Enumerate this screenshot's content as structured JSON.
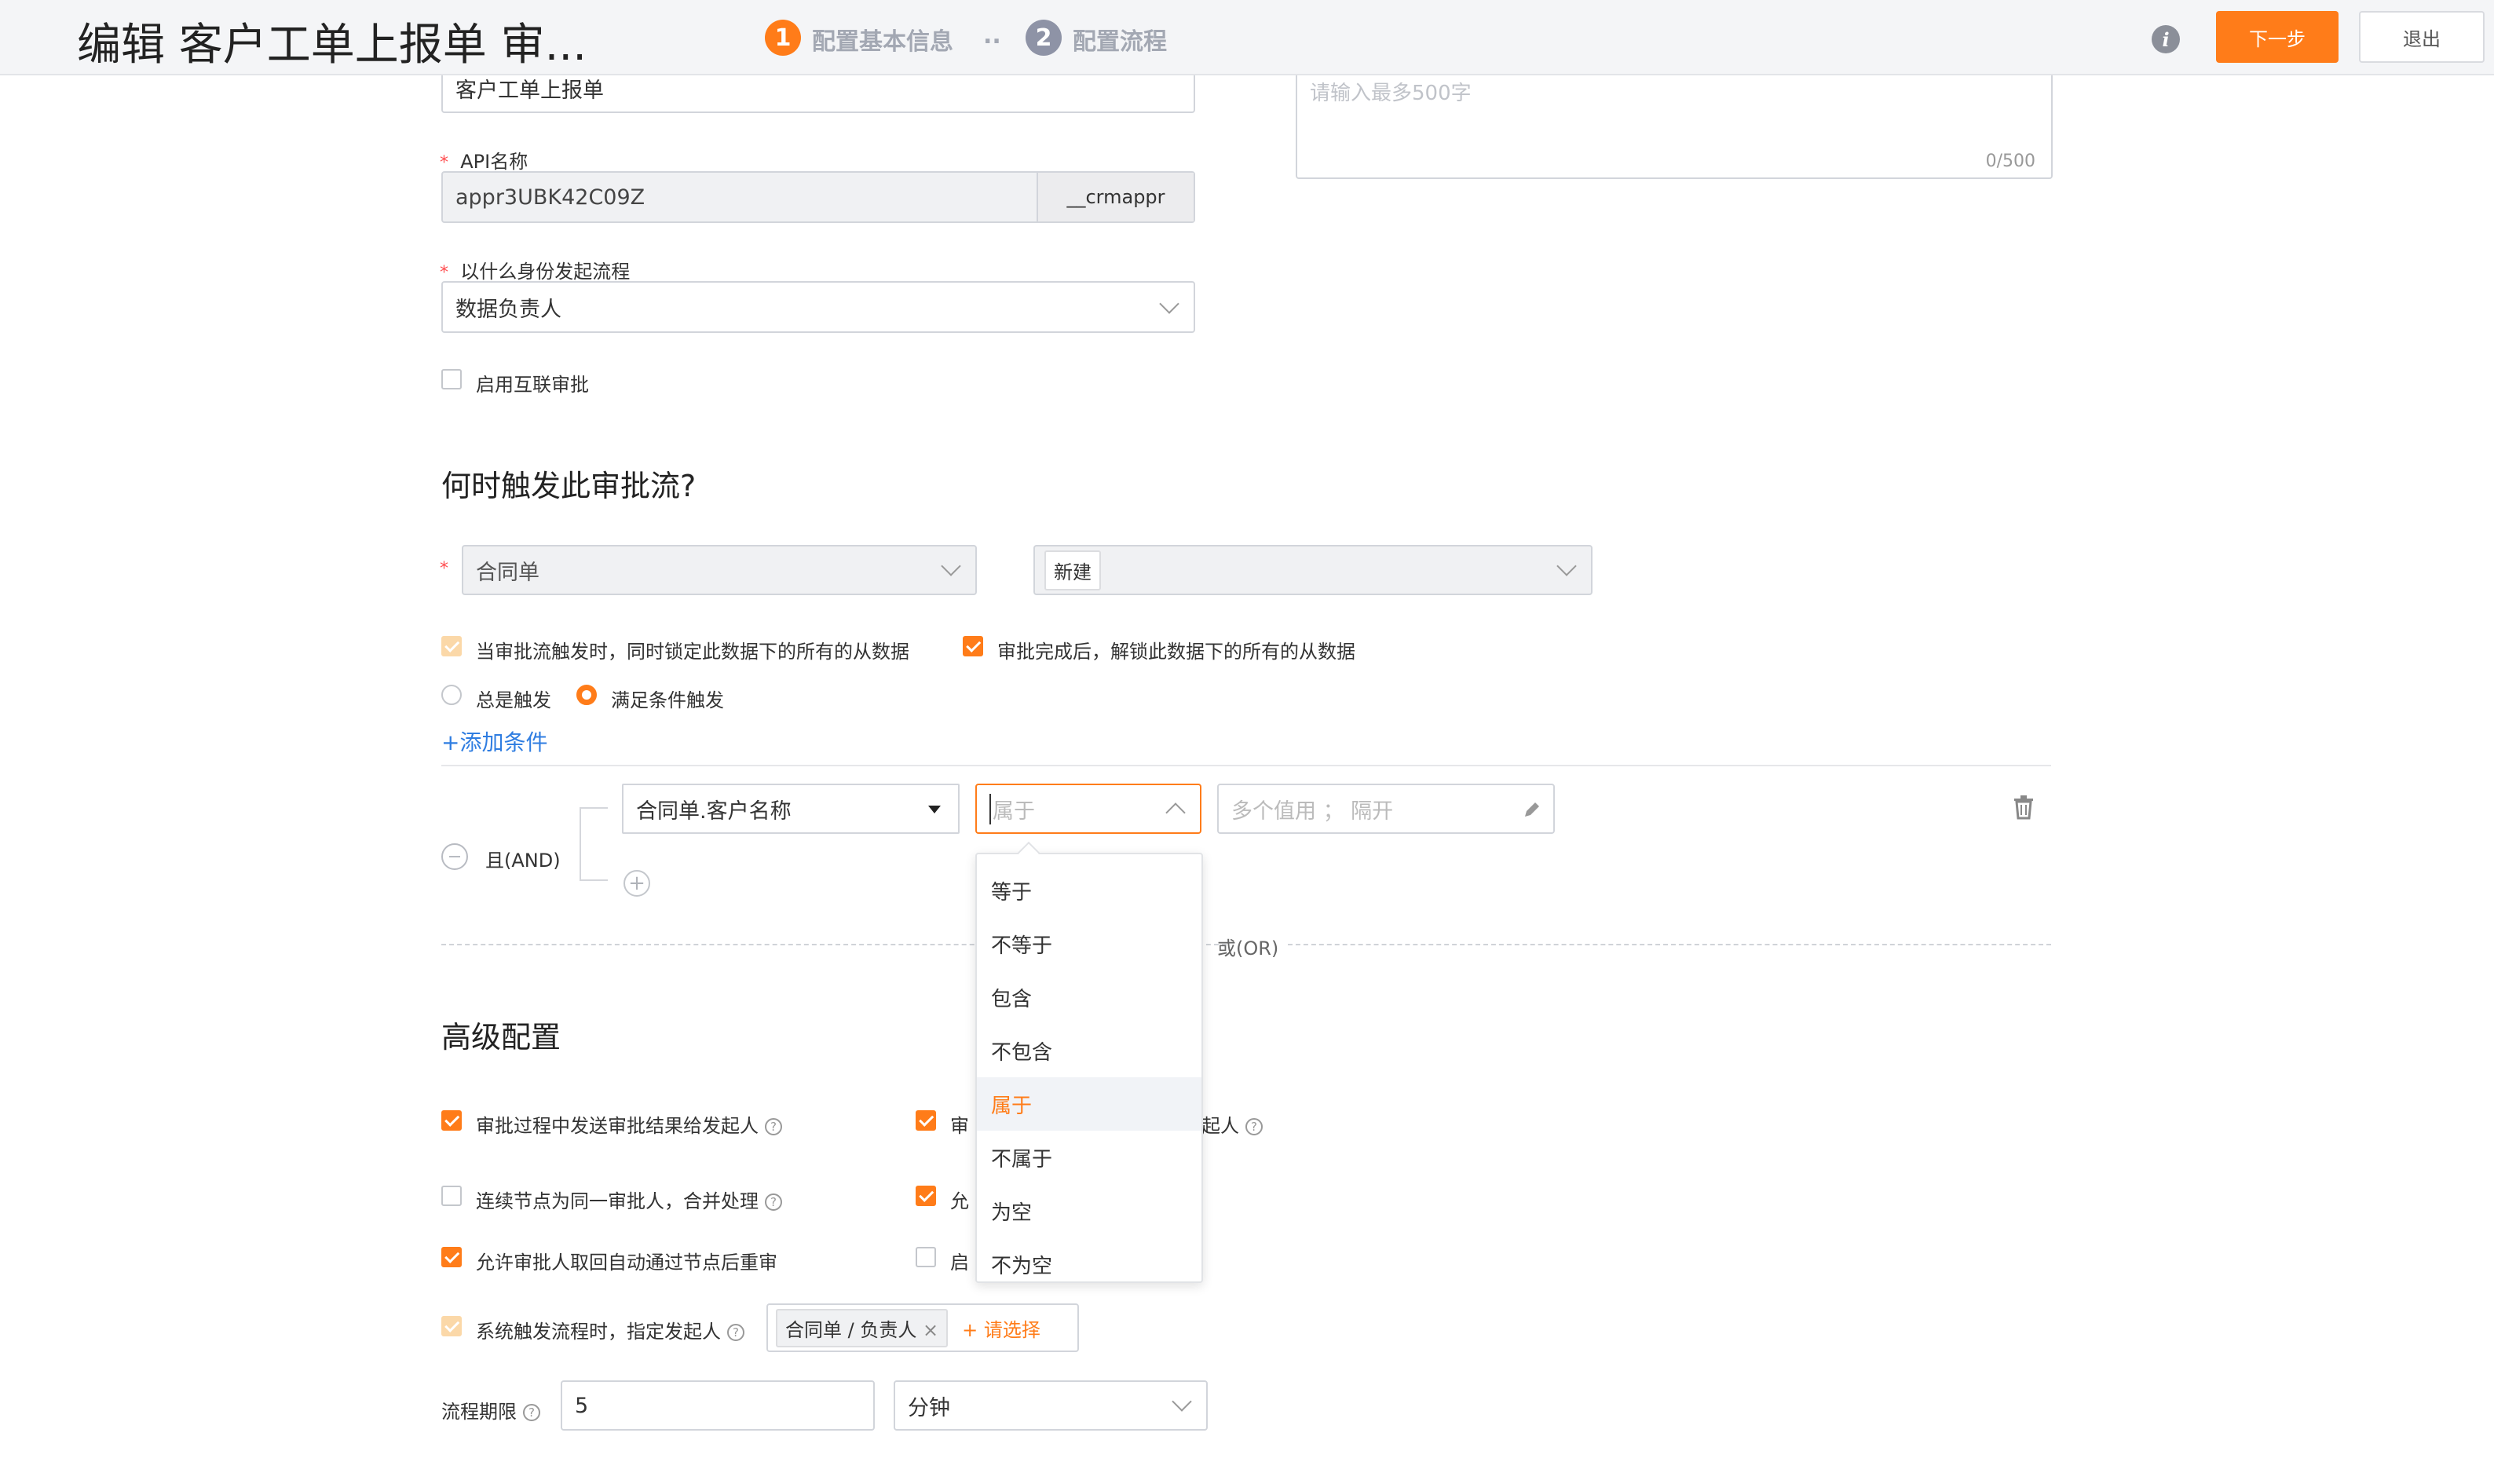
{
  "header": {
    "title": "编辑 客户工单上报单 审...",
    "steps": [
      {
        "num": "1",
        "label": "配置基本信息"
      },
      {
        "num": "2",
        "label": "配置流程"
      }
    ],
    "step_separator": "..",
    "next_label": "下一步",
    "exit_label": "退出"
  },
  "basic": {
    "name_value": "客户工单上报单",
    "description_placeholder": "请输入最多500字",
    "description_counter": "0/500",
    "api_label": "API名称",
    "api_value": "appr3UBK42C09Z",
    "api_suffix": "__crmappr",
    "initiator_label": "以什么身份发起流程",
    "initiator_value": "数据负责人",
    "interconnect_label": "启用互联审批"
  },
  "trigger": {
    "heading": "何时触发此审批流?",
    "object_value": "合同单",
    "action_tag": "新建",
    "lock_label": "当审批流触发时，同时锁定此数据下的所有的从数据",
    "unlock_label": "审批完成后，解锁此数据下的所有的从数据",
    "radio_always": "总是触发",
    "radio_conditional": "满足条件触发",
    "add_condition": "+添加条件",
    "and_label": "且(AND)",
    "or_label": "或(OR)",
    "condition": {
      "field": "合同单.客户名称",
      "operator_placeholder": "属于",
      "value_placeholder": "多个值用 ； 隔开"
    },
    "operator_options": [
      "等于",
      "不等于",
      "包含",
      "不包含",
      "属于",
      "不属于",
      "为空",
      "不为空"
    ],
    "operator_selected": "属于"
  },
  "advanced": {
    "heading": "高级配置",
    "opt_send_result": "审批过程中发送审批结果给发起人",
    "opt_col2_row1_prefix": "审",
    "opt_col2_row1_suffix": "起人",
    "opt_merge": "连续节点为同一审批人，合并处理",
    "opt_col2_row2_prefix": "允",
    "opt_reapprove": "允许审批人取回自动通过节点后重审",
    "opt_col2_row3_prefix": "启",
    "opt_system_trigger": "系统触发流程时，指定发起人",
    "initiator_tag": "合同单 / 负责人",
    "please_select": "+ 请选择",
    "deadline_label": "流程期限",
    "deadline_value": "5",
    "deadline_unit": "分钟"
  },
  "colors": {
    "accent": "#ff7c19",
    "link": "#2f7de1"
  }
}
